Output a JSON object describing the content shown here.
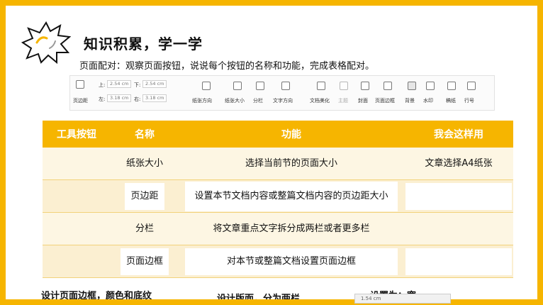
{
  "header": {
    "title": "知识积累，学一学",
    "instruction": "页面配对：观察页面按钮，说说每个按钮的名称和功能，完成表格配对。"
  },
  "ribbon": {
    "margins_label": "页边距",
    "top_label": "上:",
    "top_value": "2.54",
    "top_unit": "cm",
    "bottom_label": "下:",
    "bottom_value": "2.54",
    "bottom_unit": "cm",
    "left_label": "左:",
    "left_value": "3.18",
    "left_unit": "cm",
    "right_label": "右:",
    "right_value": "3.18",
    "right_unit": "cm",
    "orientation_label": "纸张方向",
    "size_label": "纸张大小",
    "columns_label": "分栏",
    "text_direction_label": "文字方向",
    "doc_beautify_label": "文档美化",
    "theme_label": "主题",
    "cover_label": "封面",
    "border_label": "页面边框",
    "background_label": "背景",
    "watermark_label": "水印",
    "draft_label": "稿纸",
    "line_number_label": "行号"
  },
  "table": {
    "headers": [
      "工具按钮",
      "名称",
      "功能",
      "我会这样用"
    ],
    "rows": [
      {
        "name": "纸张大小",
        "function": "选择当前节的页面大小",
        "usage": "文章选择A4纸张"
      },
      {
        "name": "页边距",
        "function": "设置本节文档内容或整篇文档内容的页边距大小",
        "usage": ""
      },
      {
        "name": "分栏",
        "function": "将文章重点文字拆分成两栏或者更多栏",
        "usage": ""
      },
      {
        "name": "页面边框",
        "function": "对本节或整篇文档设置页面边框",
        "usage": ""
      }
    ]
  },
  "bottom": {
    "note1": "设计页面边框，颜色和底纹",
    "note2": "设计版面，分为两栏",
    "note3": "设置为：宽"
  },
  "status_bar": {
    "text": "1.54  cm"
  },
  "colors": {
    "accent": "#f6b500",
    "row_light": "#fdf6e3",
    "row_dark": "#fbefd1"
  }
}
